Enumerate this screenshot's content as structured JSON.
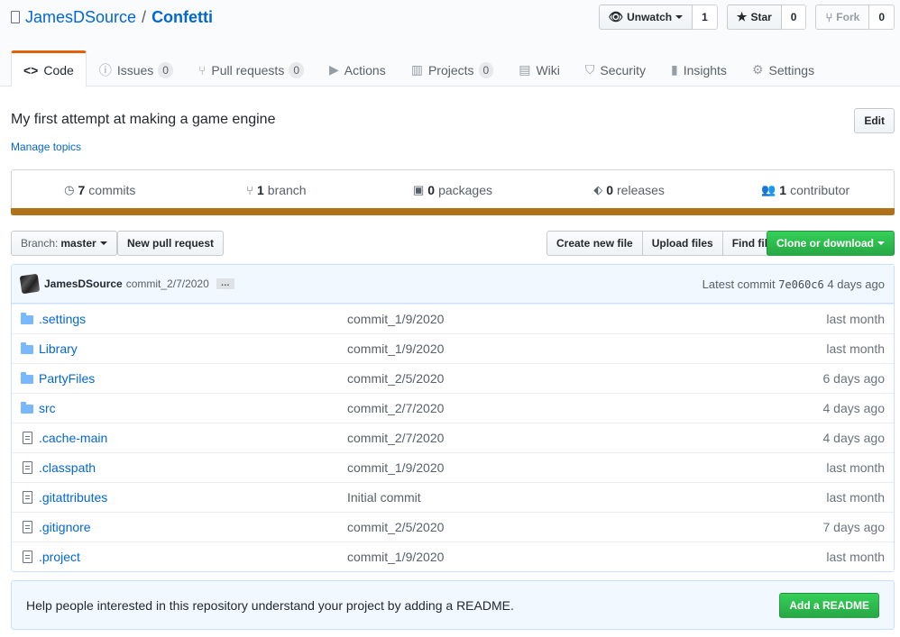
{
  "repo": {
    "owner": "JamesDSource",
    "separator": "/",
    "name": "Confetti"
  },
  "header_actions": {
    "watch": {
      "label": "Unwatch",
      "count": "1"
    },
    "star": {
      "label": "Star",
      "count": "0"
    },
    "fork": {
      "label": "Fork",
      "count": "0"
    }
  },
  "tabs": [
    {
      "label": "Code",
      "icon": "code-icon"
    },
    {
      "label": "Issues",
      "counter": "0",
      "icon": "issue-icon"
    },
    {
      "label": "Pull requests",
      "counter": "0",
      "icon": "pull-request-icon"
    },
    {
      "label": "Actions",
      "icon": "play-icon"
    },
    {
      "label": "Projects",
      "counter": "0",
      "icon": "project-icon"
    },
    {
      "label": "Wiki",
      "icon": "book-icon"
    },
    {
      "label": "Security",
      "icon": "shield-icon"
    },
    {
      "label": "Insights",
      "icon": "graph-icon"
    },
    {
      "label": "Settings",
      "icon": "gear-icon"
    }
  ],
  "description": "My first attempt at making a game engine",
  "edit_label": "Edit",
  "manage_topics": "Manage topics",
  "summary": {
    "commits": {
      "count": "7",
      "label": "commits"
    },
    "branches": {
      "count": "1",
      "label": "branch"
    },
    "packages": {
      "count": "0",
      "label": "packages"
    },
    "releases": {
      "count": "0",
      "label": "releases"
    },
    "contributors": {
      "count": "1",
      "label": "contributor"
    }
  },
  "language_color": "#b07219",
  "filebar": {
    "branch_label": "Branch:",
    "branch_value": "master",
    "new_pr": "New pull request",
    "create_file": "Create new file",
    "upload_files": "Upload files",
    "find_file": "Find file",
    "clone": "Clone or download"
  },
  "commit_tease": {
    "author": "JamesDSource",
    "message": "commit_2/7/2020",
    "ellipsis": "…",
    "latest_label": "Latest commit",
    "sha": "7e060c6",
    "age": "4 days ago"
  },
  "files": [
    {
      "name": ".settings",
      "type": "folder",
      "message": "commit_1/9/2020",
      "age": "last month"
    },
    {
      "name": "Library",
      "type": "folder",
      "message": "commit_1/9/2020",
      "age": "last month"
    },
    {
      "name": "PartyFiles",
      "type": "folder",
      "message": "commit_2/5/2020",
      "age": "6 days ago"
    },
    {
      "name": "src",
      "type": "folder",
      "message": "commit_2/7/2020",
      "age": "4 days ago"
    },
    {
      "name": ".cache-main",
      "type": "file",
      "message": "commit_2/7/2020",
      "age": "4 days ago"
    },
    {
      "name": ".classpath",
      "type": "file",
      "message": "commit_1/9/2020",
      "age": "last month"
    },
    {
      "name": ".gitattributes",
      "type": "file",
      "message": "Initial commit",
      "age": "last month"
    },
    {
      "name": ".gitignore",
      "type": "file",
      "message": "commit_2/5/2020",
      "age": "7 days ago"
    },
    {
      "name": ".project",
      "type": "file",
      "message": "commit_1/9/2020",
      "age": "last month"
    }
  ],
  "readme": {
    "text": "Help people interested in this repository understand your project by adding a README.",
    "button": "Add a README"
  }
}
